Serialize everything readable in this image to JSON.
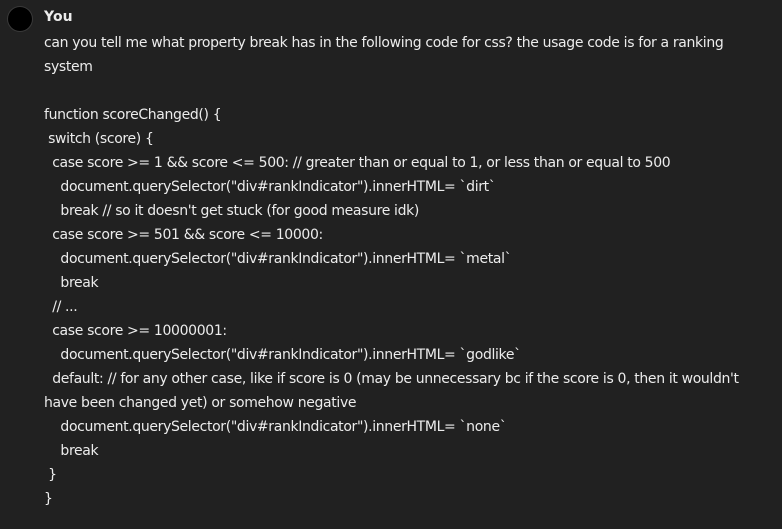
{
  "message": {
    "author": "You",
    "lines": [
      "can you tell me what property break has in the following code for css? the usage code is for a ranking",
      "system",
      "",
      "function scoreChanged() {",
      " switch (score) {",
      "  case score >= 1 && score <= 500: // greater than or equal to 1, or less than or equal to 500",
      "    document.querySelector(\"div#rankIndicator\").innerHTML= `dirt`",
      "    break // so it doesn't get stuck (for good measure idk)",
      "  case score >= 501 && score <= 10000:",
      "    document.querySelector(\"div#rankIndicator\").innerHTML= `metal`",
      "    break",
      "  // ...",
      "  case score >= 10000001:",
      "    document.querySelector(\"div#rankIndicator\").innerHTML= `godlike`",
      "  default: // for any other case, like if score is 0 (may be unnecessary bc if the score is 0, then it wouldn't",
      "have been changed yet) or somehow negative",
      "    document.querySelector(\"div#rankIndicator\").innerHTML= `none`",
      "    break",
      " }",
      "}"
    ]
  },
  "colors": {
    "background": "#212121",
    "text": "#ececec",
    "avatar": "#000000"
  }
}
